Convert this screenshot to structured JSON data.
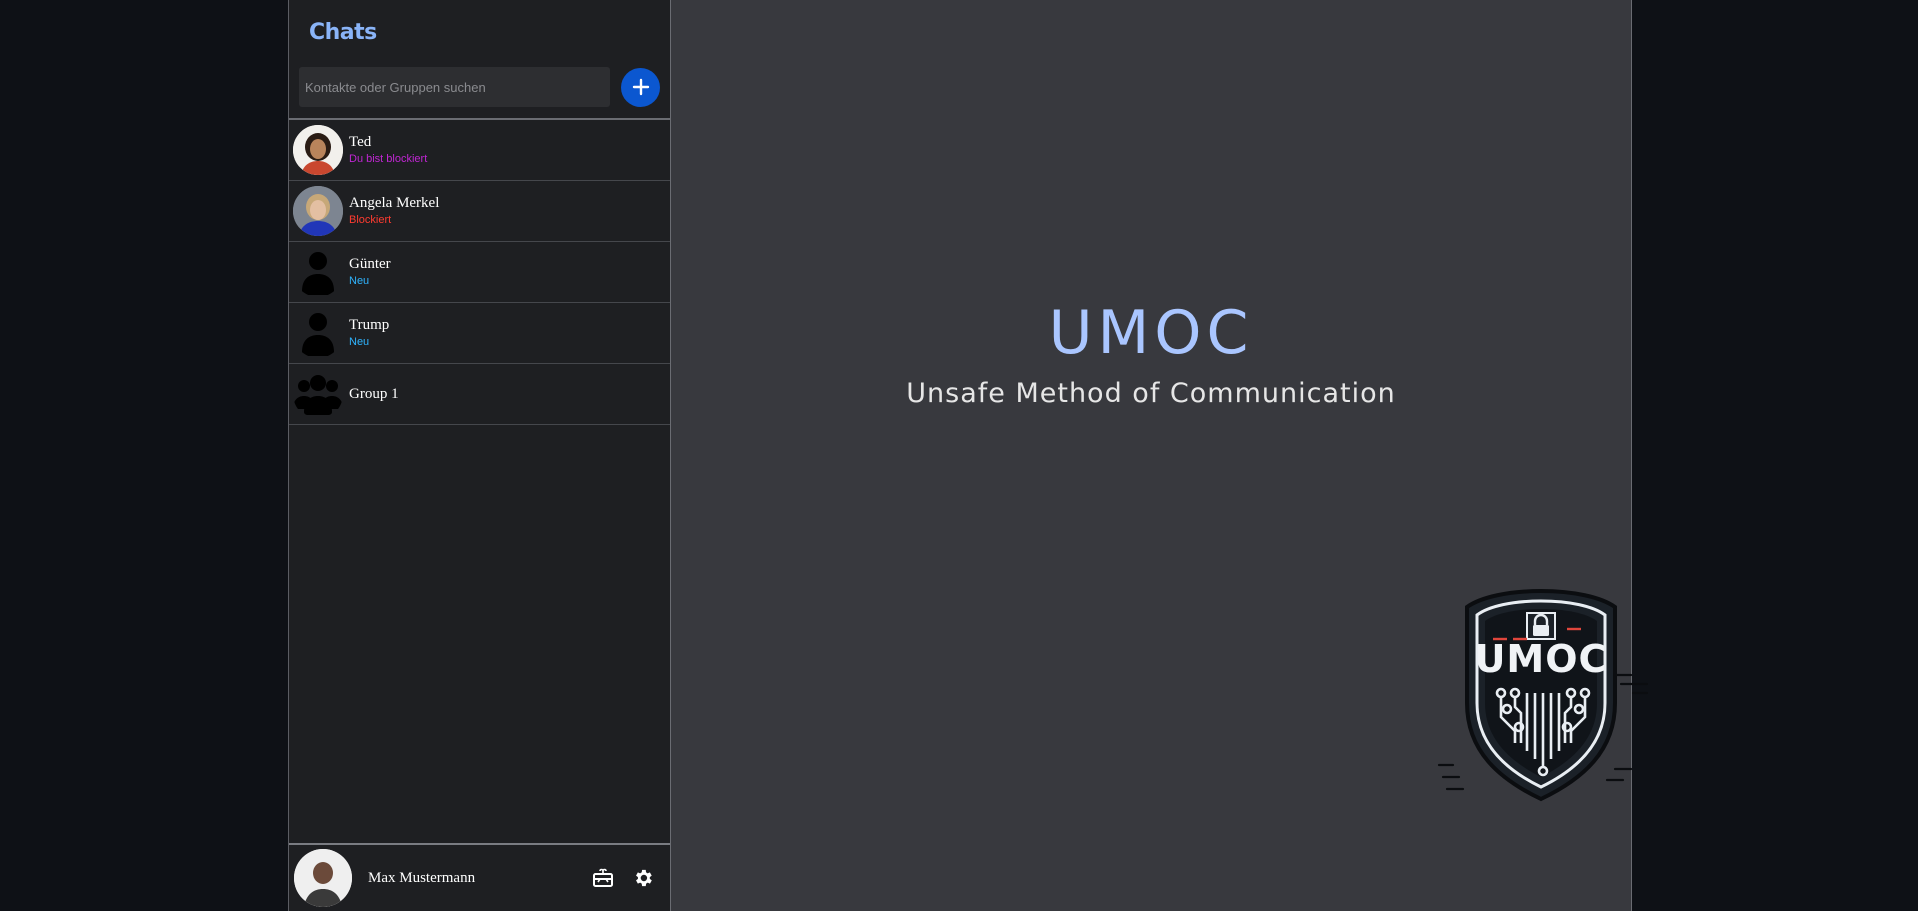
{
  "sidebar": {
    "title": "Chats",
    "search": {
      "placeholder": "Kontakte oder Gruppen suchen",
      "value": ""
    },
    "add_icon": "plus-icon",
    "chats": [
      {
        "name": "Ted",
        "status": "Du bist blockiert",
        "status_color": "#c026d3",
        "avatar": "photo"
      },
      {
        "name": "Angela Merkel",
        "status": "Blockiert",
        "status_color": "#ff3b30",
        "avatar": "photo"
      },
      {
        "name": "Günter",
        "status": "Neu",
        "status_color": "#2fb4ff",
        "avatar": "person-icon"
      },
      {
        "name": "Trump",
        "status": "Neu",
        "status_color": "#2fb4ff",
        "avatar": "person-icon"
      },
      {
        "name": "Group 1",
        "status": "",
        "status_color": "",
        "avatar": "group-icon"
      }
    ],
    "footer": {
      "user_name": "Max Mustermann",
      "icons": [
        "gift-card-icon",
        "gear-icon"
      ]
    }
  },
  "main": {
    "title": "UMOC",
    "subtitle": "Unsafe Method of Communication",
    "logo_text": "UMOC"
  },
  "colors": {
    "accent": "#0b57d0",
    "title_blue": "#8ab4f8",
    "brand_blue": "#aac6ff"
  }
}
